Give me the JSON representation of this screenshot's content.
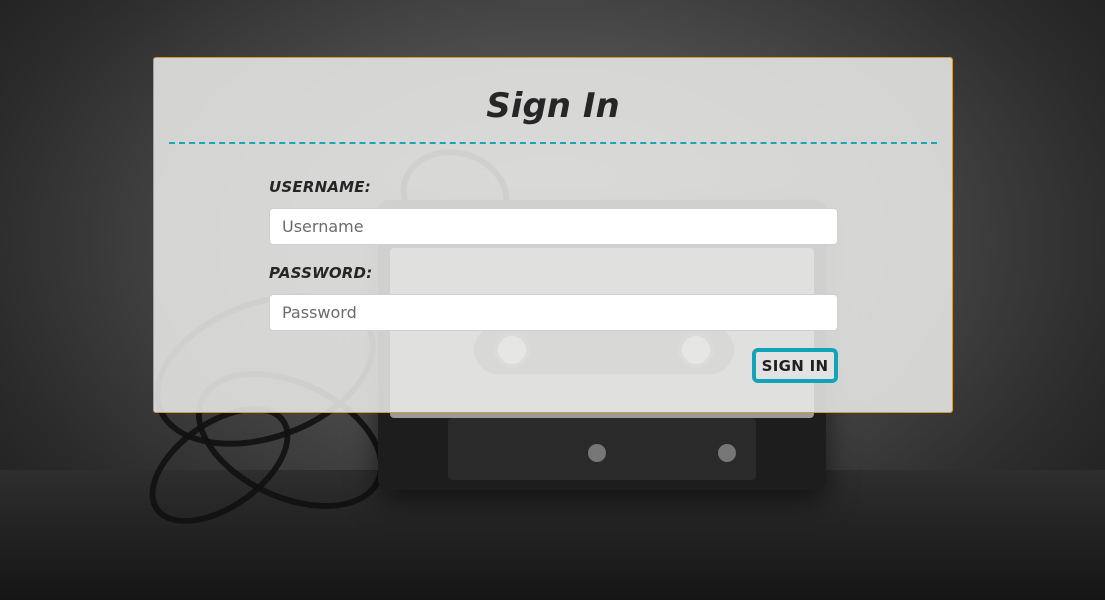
{
  "login": {
    "title": "Sign In",
    "username": {
      "label": "USERNAME:",
      "placeholder": "Username",
      "value": ""
    },
    "password": {
      "label": "PASSWORD:",
      "placeholder": "Password",
      "value": ""
    },
    "submit_label": "SIGN IN"
  },
  "colors": {
    "accent": "#1aa6b7",
    "card_border": "#d49a3a",
    "text": "#262626"
  }
}
